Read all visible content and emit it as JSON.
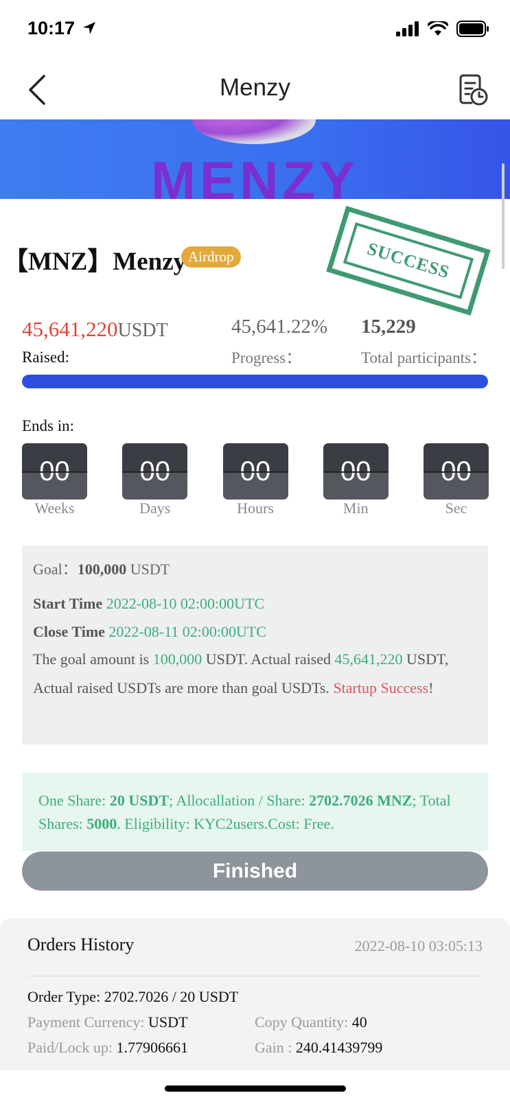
{
  "status": {
    "time": "10:17"
  },
  "nav": {
    "title": "Menzy"
  },
  "banner": {
    "word": "MENZY"
  },
  "project": {
    "title": "【MNZ】Menzy",
    "tag": "Airdrop",
    "stamp": "SUCCESS"
  },
  "stats": {
    "raised_value": "45,641,220",
    "raised_unit": "USDT",
    "raised_label": "Raised:",
    "progress_value": "45,641.22%",
    "progress_label": "Progress：",
    "participants_value": "15,229",
    "participants_label": "Total participants：",
    "progress_fraction": 1.0
  },
  "countdown": {
    "label": "Ends in:",
    "units": [
      {
        "value": "00",
        "label": "Weeks"
      },
      {
        "value": "00",
        "label": "Days"
      },
      {
        "value": "00",
        "label": "Hours"
      },
      {
        "value": "00",
        "label": "Min"
      },
      {
        "value": "00",
        "label": "Sec"
      }
    ]
  },
  "goal": {
    "goal_label": "Goal：",
    "goal_value": "100,000",
    "goal_unit": "USDT",
    "start_label": "Start Time",
    "start_value": "2022-08-10 02:00:00UTC",
    "close_label": "Close Time",
    "close_value": "2022-08-11 02:00:00UTC",
    "desc_1": "The goal amount is ",
    "desc_goal": "100,000",
    "desc_2": " USDT. Actual raised ",
    "desc_raised": "45,641,220",
    "desc_3": " USDT, Actual raised USDTs are more than goal USDTs. ",
    "desc_status": "Startup Success",
    "desc_4": "!"
  },
  "share": {
    "one_share_label": "One Share: ",
    "one_share_value": "20 USDT",
    "alloc_label": "; Allocallation / Share: ",
    "alloc_value": "2702.7026 MNZ",
    "total_label": "; Total Shares: ",
    "total_value": "5000",
    "elig": ". Eligibility: KYC2users.Cost: Free."
  },
  "button": {
    "finished": "Finished"
  },
  "orders": {
    "title": "Orders History",
    "date": "2022-08-10 03:05:13",
    "order_type_label": "Order Type: ",
    "order_type_value": "2702.7026 / 20 USDT",
    "payment_label": "Payment Currency: ",
    "payment_value": "USDT",
    "copy_label": "Copy Quantity: ",
    "copy_value": "40",
    "paid_label": "Paid/Lock up: ",
    "paid_value": "1.77906661",
    "gain_label": "Gain : ",
    "gain_value": "240.41439799"
  },
  "colors": {
    "accent": "#2d4fe0",
    "raised": "#e0443a",
    "green": "#3cae7a",
    "tag": "#e3a93a"
  }
}
